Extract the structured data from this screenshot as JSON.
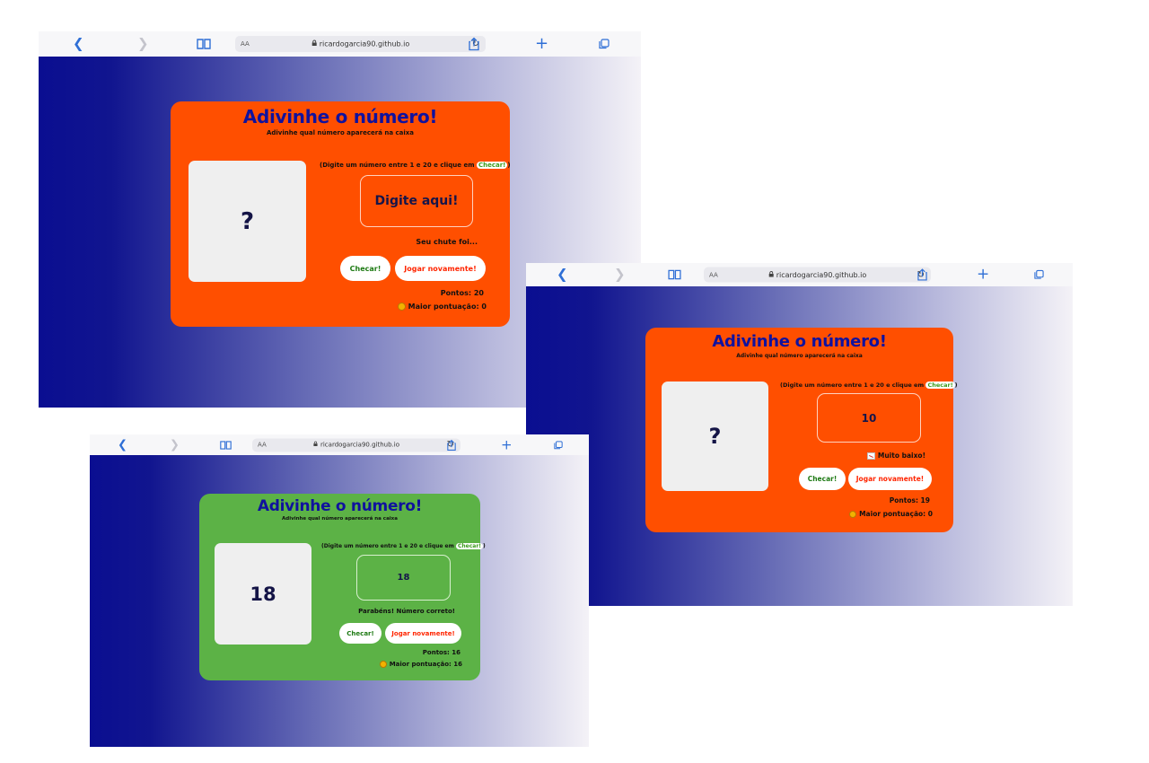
{
  "browser": {
    "url": "ricardogarcia90.github.io",
    "reader_label": "AA"
  },
  "game": {
    "title": "Adivinhe o número!",
    "subtitle": "Adivinhe qual número aparecerá na caixa",
    "instruction_prefix": "(Digite um número entre 1 e 20 e clique em",
    "instruction_chip": "Checar!",
    "instruction_suffix": ")",
    "check_label": "Checar!",
    "replay_label": "Jogar novamente!"
  },
  "screens": [
    {
      "card_color": "#ff4f00",
      "secret": "?",
      "input_value": "",
      "input_placeholder": "Digite aqui!",
      "feedback": "Seu chute foi...",
      "score": "Pontos: 20",
      "highscore": "Maior pontuação: 0"
    },
    {
      "card_color": "#ff4f00",
      "secret": "?",
      "input_value": "10",
      "feedback": "Muito baixo!",
      "feedback_icon": "chart-decreasing-icon",
      "score": "Pontos: 19",
      "highscore": "Maior pontuação: 0"
    },
    {
      "card_color": "#5cb246",
      "secret": "18",
      "input_value": "18",
      "feedback": "Parabéns! Número correto!",
      "score": "Pontos: 16",
      "highscore": "Maior pontuação: 16"
    }
  ],
  "colors": {
    "page_gradient_start": "#0a0e91",
    "page_gradient_end": "#f4f2f7",
    "title": "#10129e",
    "check_text": "#1e7a14",
    "replay_text": "#ff2500"
  }
}
